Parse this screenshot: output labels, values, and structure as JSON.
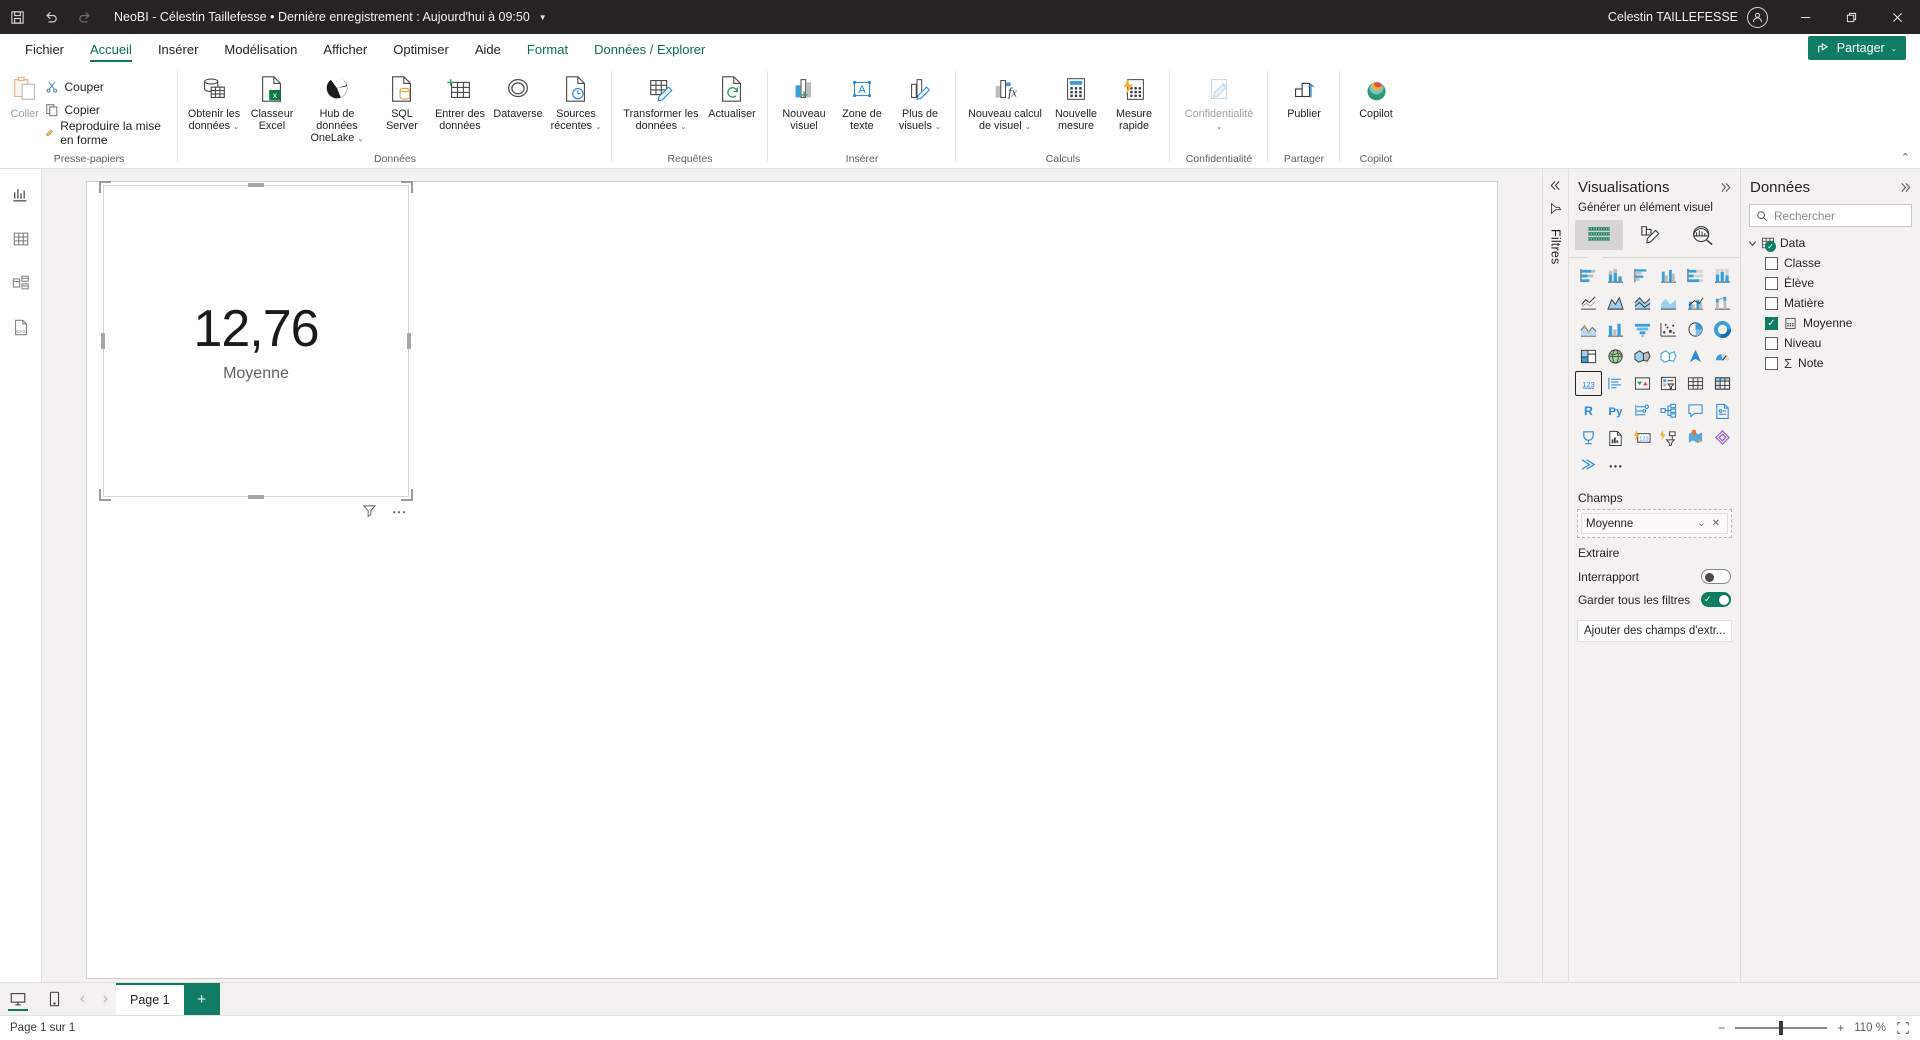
{
  "titlebar": {
    "save_icon": "save-icon",
    "undo_icon": "undo-icon",
    "redo_icon": "redo-icon",
    "title": "NeoBI - Célestin Taillefesse • Dernière enregistrement : Aujourd'hui à 09:50",
    "caret": "▼",
    "user": "Celestin TAILLEFESSE",
    "minimize": "—",
    "restore": "❐",
    "close": "✕"
  },
  "ribbon_tabs": {
    "items": [
      {
        "label": "Fichier",
        "active": false,
        "contextual": false
      },
      {
        "label": "Accueil",
        "active": true,
        "contextual": false
      },
      {
        "label": "Insérer",
        "active": false,
        "contextual": false
      },
      {
        "label": "Modélisation",
        "active": false,
        "contextual": false
      },
      {
        "label": "Afficher",
        "active": false,
        "contextual": false
      },
      {
        "label": "Optimiser",
        "active": false,
        "contextual": false
      },
      {
        "label": "Aide",
        "active": false,
        "contextual": false
      },
      {
        "label": "Format",
        "active": false,
        "contextual": true
      },
      {
        "label": "Données / Explorer",
        "active": false,
        "contextual": true
      }
    ],
    "share_label": "Partager",
    "share_caret": "⌄",
    "accent": "#107c63"
  },
  "ribbon": {
    "collapse_icon": "chevron-up-icon",
    "groups": [
      {
        "label": "Presse-papiers",
        "paste": "Coller",
        "small_items": [
          {
            "label": "Couper",
            "icon": "scissors-icon"
          },
          {
            "label": "Copier",
            "icon": "copy-icon"
          },
          {
            "label": "Reproduire la mise en forme",
            "icon": "format-painter-icon"
          }
        ]
      },
      {
        "label": "Données",
        "items": [
          {
            "label": "Obtenir les données",
            "caret": true,
            "icon": "get-data-icon"
          },
          {
            "label": "Classeur Excel",
            "caret": false,
            "icon": "excel-icon"
          },
          {
            "label": "Hub de données OneLake",
            "caret": true,
            "icon": "onelake-icon"
          },
          {
            "label": "SQL Server",
            "caret": false,
            "icon": "sql-server-icon"
          },
          {
            "label": "Entrer des données",
            "caret": false,
            "icon": "enter-data-icon"
          },
          {
            "label": "Dataverse",
            "caret": false,
            "icon": "dataverse-icon"
          },
          {
            "label": "Sources récentes",
            "caret": true,
            "icon": "recent-sources-icon"
          }
        ]
      },
      {
        "label": "Requêtes",
        "items": [
          {
            "label": "Transformer les données",
            "caret": true,
            "icon": "transform-data-icon"
          },
          {
            "label": "Actualiser",
            "caret": false,
            "icon": "refresh-icon"
          }
        ]
      },
      {
        "label": "Insérer",
        "items": [
          {
            "label": "Nouveau visuel",
            "caret": false,
            "icon": "new-visual-icon"
          },
          {
            "label": "Zone de texte",
            "caret": false,
            "icon": "text-box-icon"
          },
          {
            "label": "Plus de visuels",
            "caret": true,
            "icon": "more-visuals-icon"
          }
        ]
      },
      {
        "label": "Calculs",
        "items": [
          {
            "label": "Nouveau calcul de visuel",
            "caret": true,
            "icon": "visual-calc-icon"
          },
          {
            "label": "Nouvelle mesure",
            "caret": false,
            "icon": "new-measure-icon"
          },
          {
            "label": "Mesure rapide",
            "caret": false,
            "icon": "quick-measure-icon"
          }
        ]
      },
      {
        "label": "Confidentialité",
        "items": [
          {
            "label": "Confidentialité",
            "caret": true,
            "icon": "sensitivity-icon",
            "disabled": true
          }
        ]
      },
      {
        "label": "Partager",
        "items": [
          {
            "label": "Publier",
            "caret": false,
            "icon": "publish-icon"
          }
        ]
      },
      {
        "label": "Copilot",
        "items": [
          {
            "label": "Copilot",
            "caret": false,
            "icon": "copilot-icon"
          }
        ]
      }
    ]
  },
  "left_rail": {
    "items": [
      {
        "name": "report-view",
        "icon": "report-bar-chart-icon",
        "active": true
      },
      {
        "name": "table-view",
        "icon": "table-grid-icon",
        "active": false
      },
      {
        "name": "model-view",
        "icon": "model-relationship-icon",
        "active": false
      },
      {
        "name": "dax-query-view",
        "icon": "dax-query-icon",
        "active": false
      }
    ]
  },
  "canvas": {
    "card_visual": {
      "value": "12,76",
      "label": "Moyenne",
      "filter_icon": "filter-funnel-icon",
      "more_icon": "more-options-icon"
    }
  },
  "filters_pane": {
    "collapse_icon": "chevron-double-left-icon",
    "filter_icon": "filter-funnel-icon",
    "label": "Filtres"
  },
  "visualizations": {
    "title": "Visualisations",
    "expand_icon": "chevron-double-right-icon",
    "subtitle": "Générer un élément visuel",
    "generate_buttons": [
      {
        "name": "build-visual",
        "icon": "build-visual-icon",
        "active": true
      },
      {
        "name": "format-visual",
        "icon": "format-visual-icon",
        "active": false
      },
      {
        "name": "analytics-visual",
        "icon": "analytics-magnifier-icon",
        "active": false
      }
    ],
    "gallery": [
      "stacked-bar-chart",
      "stacked-column-chart",
      "clustered-bar-chart",
      "clustered-column-chart",
      "100-stacked-bar-chart",
      "100-stacked-column-chart",
      "line-chart",
      "area-chart",
      "stacked-area-chart",
      "line-stacked-column-chart",
      "line-clustered-column-chart",
      "ribbon-chart",
      "waterfall-chart",
      "funnel-chart-alt",
      "funnel-chart",
      "scatter-chart",
      "pie-chart",
      "donut-chart",
      "treemap-chart",
      "map-chart",
      "filled-map-chart",
      "shape-map-chart",
      "azure-map-chart",
      "gauge-chart",
      "card-visual",
      "multi-row-card",
      "kpi-visual",
      "slicer-visual",
      "table-visual",
      "matrix-visual",
      "r-script-visual",
      "python-visual",
      "key-influencers",
      "decomposition-tree",
      "qna-visual",
      "smart-narrative",
      "metrics-visual",
      "paginated-report",
      "power-apps",
      "power-automate",
      "arcgis-maps",
      "more-visuals-diamond",
      "get-more-visuals",
      "ellipsis-more"
    ],
    "selected_gallery_index": 24,
    "fields_title": "Champs",
    "field_chip": {
      "name": "Moyenne",
      "dropdown_icon": "chevron-down-icon",
      "remove_icon": "close-icon"
    },
    "drillthrough_title": "Extraire",
    "cross_report_label": "Interrapport",
    "cross_report_state": "off",
    "keep_filters_label": "Garder tous les filtres",
    "keep_filters_state": "on",
    "add_fields_label": "Ajouter des champs d'extr...",
    "accent": "#0f7b5f"
  },
  "data_pane": {
    "title": "Données",
    "expand_icon": "chevron-double-right-icon",
    "search_placeholder": "Rechercher",
    "search_value": "",
    "search_icon": "search-icon",
    "table": {
      "name": "Data",
      "expanded": true,
      "icon": "table-icon",
      "badge_icon": "checkmark-badge-icon"
    },
    "fields": [
      {
        "label": "Classe",
        "checked": false,
        "icon": null
      },
      {
        "label": "Élève",
        "checked": false,
        "icon": null
      },
      {
        "label": "Matière",
        "checked": false,
        "icon": null
      },
      {
        "label": "Moyenne",
        "checked": true,
        "icon": "measure-calculator-icon"
      },
      {
        "label": "Niveau",
        "checked": false,
        "icon": null
      },
      {
        "label": "Note",
        "checked": false,
        "icon": "sigma-icon"
      }
    ]
  },
  "page_bar": {
    "desktop_icon": "desktop-view-icon",
    "mobile_icon": "mobile-view-icon",
    "prev_icon": "chevron-left-icon",
    "next_icon": "chevron-right-icon",
    "tabs": [
      {
        "label": "Page 1",
        "active": true
      }
    ],
    "add_label": "+"
  },
  "status_bar": {
    "page_status": "Page 1 sur 1",
    "zoom_minus": "−",
    "zoom_plus": "+",
    "zoom_level": "110 %",
    "fit_icon": "fit-to-page-icon"
  }
}
